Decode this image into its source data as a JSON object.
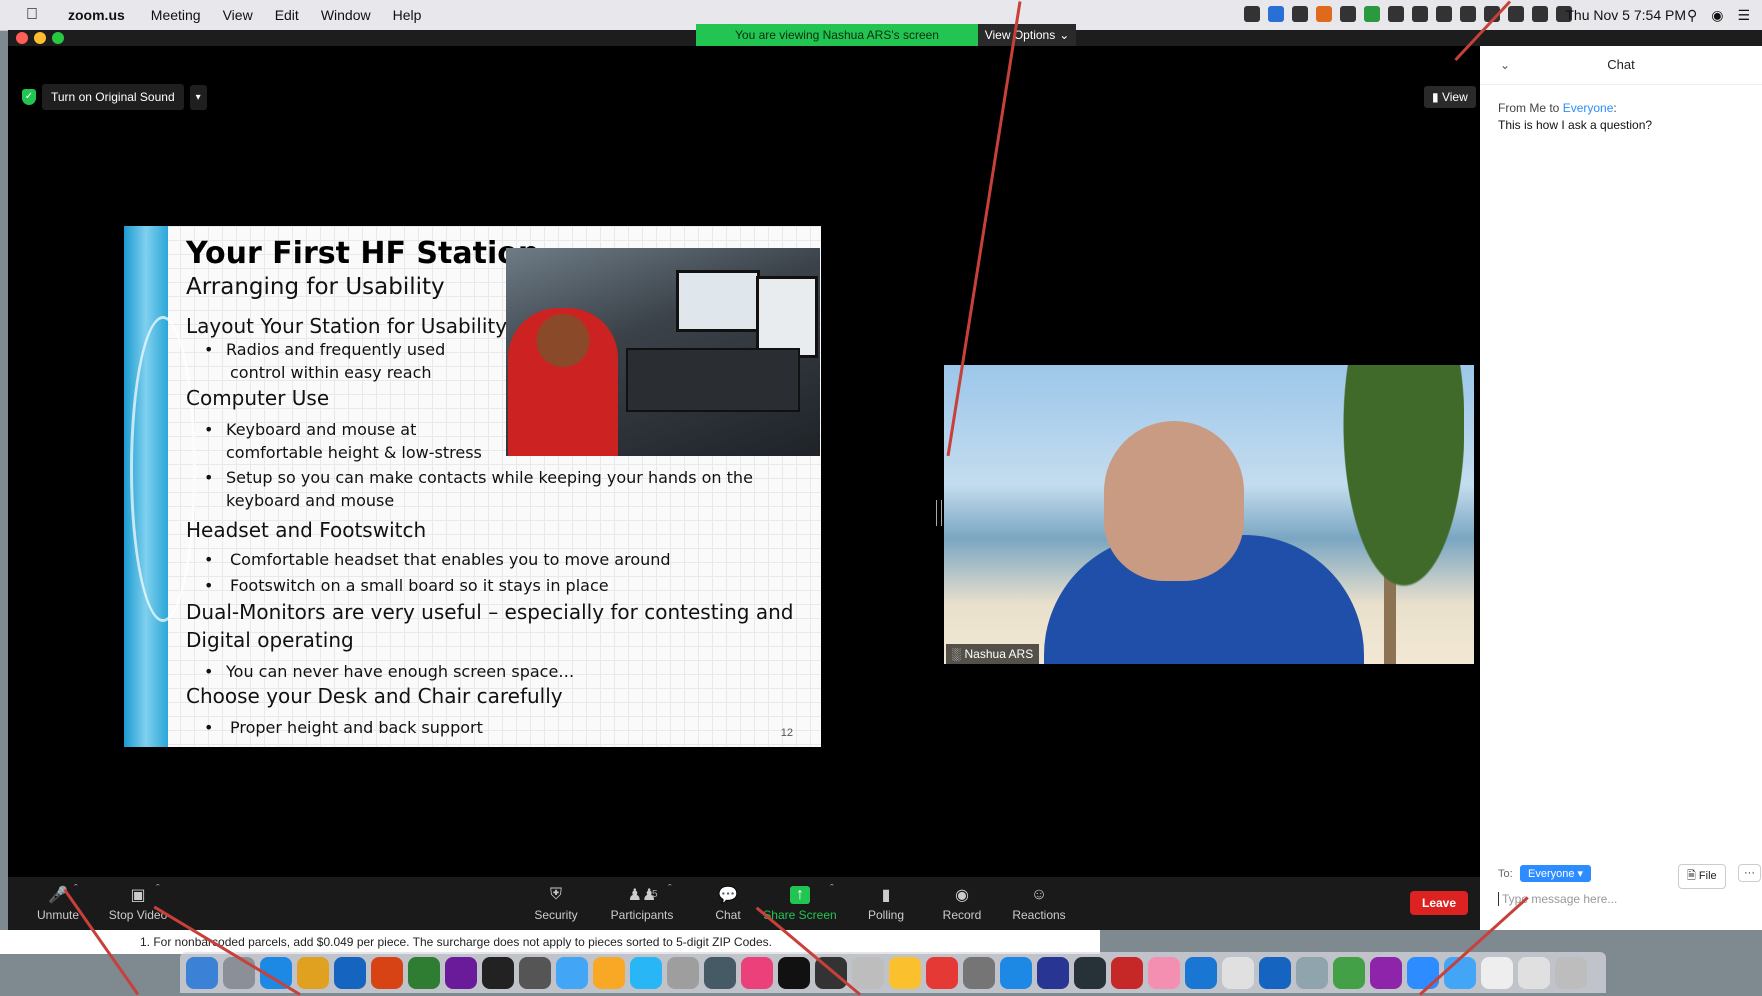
{
  "menubar": {
    "app": "zoom.us",
    "items": [
      "Meeting",
      "View",
      "Edit",
      "Window",
      "Help"
    ],
    "clock": "Thu Nov 5  7:54 PM"
  },
  "banner": {
    "viewing": "You are viewing Nashua ARS's screen",
    "view_options": "View Options"
  },
  "audio": {
    "original_sound": "Turn on Original Sound"
  },
  "view_button": "View",
  "slide": {
    "title": "Your First HF Station",
    "subtitle": "Arranging for Usability",
    "h1": "Layout Your Station for Usability",
    "b1a": "Radios and frequently used",
    "b1b": "control within easy reach",
    "h2": "Computer Use",
    "b2a": "Keyboard and mouse at",
    "b2b": "comfortable height & low-stress",
    "b3a": "Setup so you can make contacts while keeping your hands on the",
    "b3b": "keyboard and mouse",
    "h3": "Headset and Footswitch",
    "b4": "Comfortable headset that enables you to move around",
    "b5": "Footswitch on a small board so it stays in place",
    "h4a": "Dual-Monitors are very useful – especially for contesting and",
    "h4b": "Digital operating",
    "b6": "You can never have enough screen space…",
    "h5": "Choose your Desk and Chair carefully",
    "b7": "Proper height and back support",
    "page": "12"
  },
  "speaker": {
    "name": "Nashua ARS"
  },
  "chat": {
    "title": "Chat",
    "from_prefix": "From Me to",
    "from_target": "Everyone",
    "message": "This is how I ask a question?",
    "to_label": "To:",
    "recipient": "Everyone",
    "file_label": "File",
    "more_label": "···",
    "placeholder": "Type message here..."
  },
  "toolbar": {
    "unmute": "Unmute",
    "stop_video": "Stop Video",
    "security": "Security",
    "participants": "Participants",
    "participants_count": "5",
    "chat": "Chat",
    "share_screen": "Share Screen",
    "polling": "Polling",
    "record": "Record",
    "reactions": "Reactions",
    "leave": "Leave"
  },
  "background_doc": "1.  For nonbarcoded parcels, add $0.049 per piece. The surcharge does not apply to pieces sorted to 5-digit ZIP Codes.",
  "colors": {
    "accent_blue": "#2d8cff",
    "green": "#23c552",
    "leave_red": "#dd2222",
    "annotation_red": "#c8403a"
  }
}
